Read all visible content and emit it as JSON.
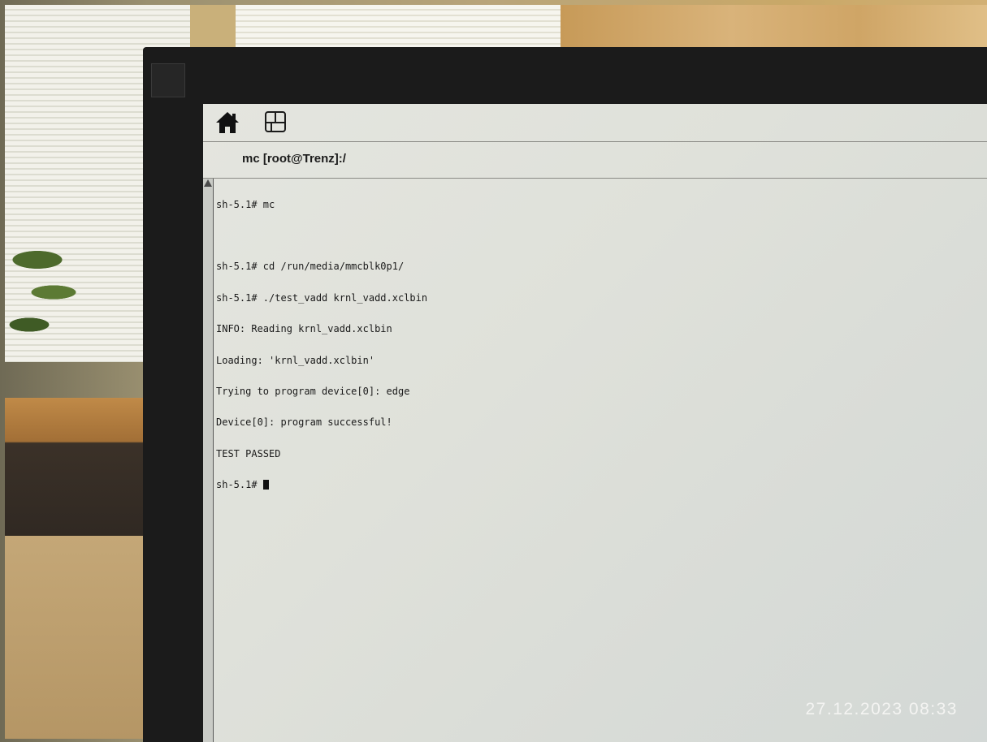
{
  "window": {
    "title": "mc [root@Trenz]:/"
  },
  "toolbar": {
    "home_icon": "home-icon",
    "windows_icon": "window-switch-icon"
  },
  "terminal": {
    "lines": [
      "sh-5.1# mc",
      "",
      "sh-5.1# cd /run/media/mmcblk0p1/",
      "sh-5.1# ./test_vadd krnl_vadd.xclbin",
      "INFO: Reading krnl_vadd.xclbin",
      "Loading: 'krnl_vadd.xclbin'",
      "Trying to program device[0]: edge",
      "Device[0]: program successful!",
      "TEST PASSED",
      "sh-5.1# "
    ]
  },
  "photo": {
    "timestamp": "27.12.2023  08:33"
  },
  "colors": {
    "screen_bg": "#e2e3dd",
    "bezel": "#1b1b1b",
    "text": "#1a1a1a"
  }
}
